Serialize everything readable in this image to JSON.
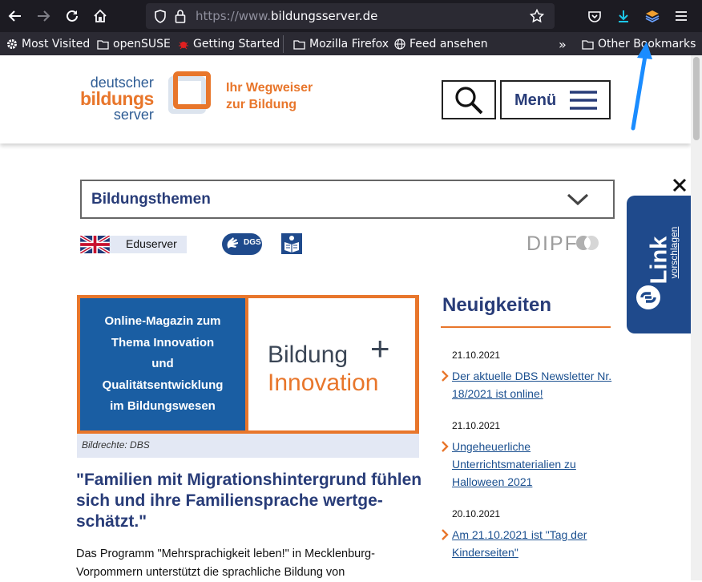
{
  "browser": {
    "url_prefix": "https://www.",
    "url_domain": "bildungsserver.de",
    "bookmarks": [
      {
        "label": "Most Visited",
        "icon": "gear-icon"
      },
      {
        "label": "openSUSE",
        "icon": "folder-icon"
      },
      {
        "label": "Getting Started",
        "icon": "bug-icon"
      },
      {
        "label": "Mozilla Firefox",
        "icon": "folder-icon"
      },
      {
        "label": "Feed ansehen",
        "icon": "globe-icon"
      },
      {
        "label": "Other Bookmarks",
        "icon": "folder-icon"
      }
    ],
    "overflow_label": "»"
  },
  "header": {
    "logo": {
      "line1": "deutscher",
      "line2": "bildungs",
      "line3": "server"
    },
    "tagline_line1": "Ihr Wegweiser",
    "tagline_line2": "zur Bildung",
    "menu_label": "Menü"
  },
  "themes": {
    "label": "Bildungsthemen"
  },
  "eduserver": {
    "label": "Eduserver"
  },
  "partner": {
    "dgs_badge": "DGS",
    "dipf": "DIPF"
  },
  "teaser": {
    "left_lines": [
      "Online-Magazin zum",
      "Thema Innovation",
      "und",
      "Qualitätsentwicklung",
      "im Bildungswesen"
    ],
    "right_line1": "Bildung",
    "right_line2": "Innovation",
    "plus": "+",
    "credit": "Bildrechte: DBS"
  },
  "article": {
    "title": "\"Familien mit Migrationshintergrund fühlen sich und ihre Familiensprache wertge­schätzt.\"",
    "body": "Das Programm \"Mehrsprachigkeit leben!\" in Mecklenburg-Vorpommern unterstützt die sprachliche Bildung von"
  },
  "news": {
    "heading": "Neuigkeiten",
    "items": [
      {
        "date": "21.10.2021",
        "title": "Der aktuelle DBS Newsletter Nr. 18/2021 ist online!"
      },
      {
        "date": "21.10.2021",
        "title": "Ungeheuerliche Unterrichtsmaterialien zu Halloween 2021"
      },
      {
        "date": "20.10.2021",
        "title": "Am 21.10.2021 ist \"Tag der Kinderseiten\""
      }
    ]
  },
  "link_tab": {
    "word": "Link",
    "sub": "vorschlagen"
  },
  "colors": {
    "brand_blue": "#283c78",
    "brand_orange": "#e8762b",
    "toolbar": "#1c1b22",
    "annotation_arrow": "#1a8cff"
  }
}
